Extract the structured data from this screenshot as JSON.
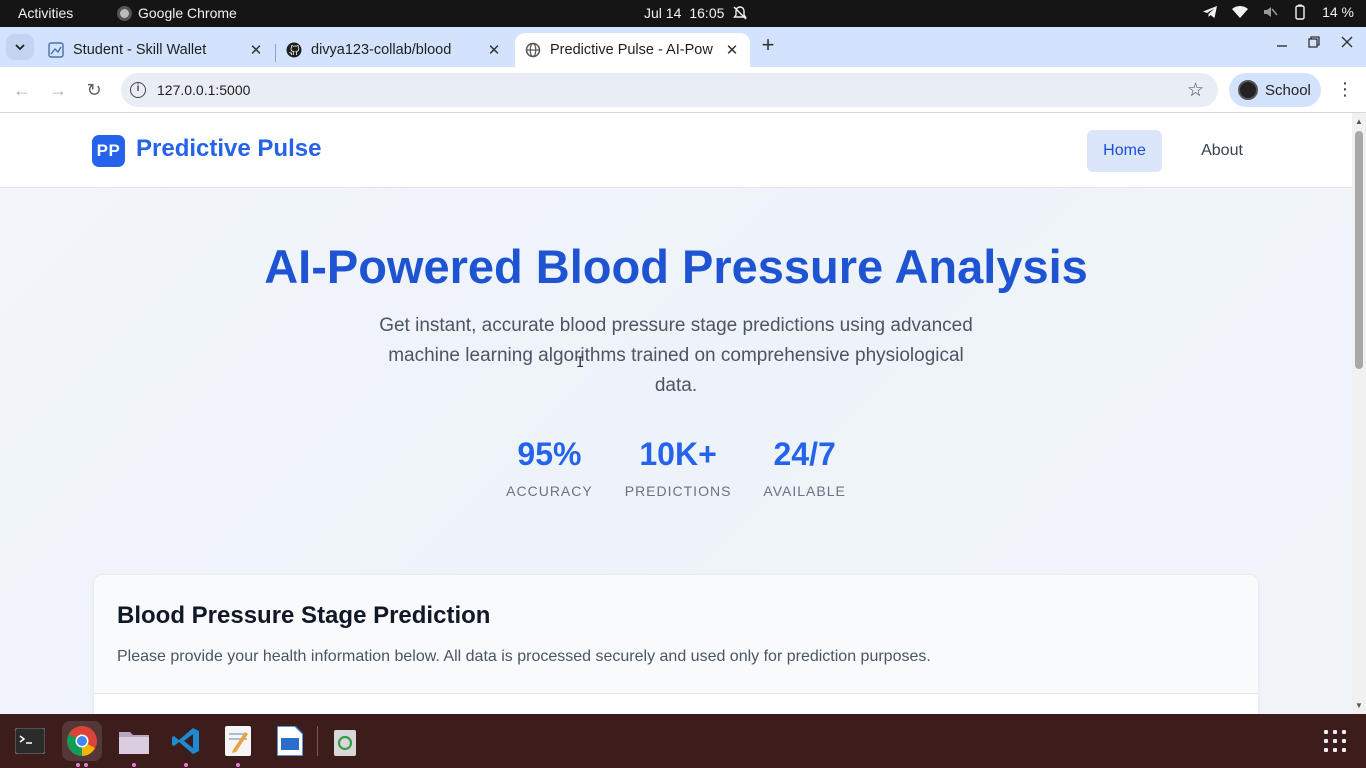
{
  "system": {
    "activities": "Activities",
    "app_name": "Google Chrome",
    "date": "Jul 14",
    "time": "16:05",
    "battery": "14 %"
  },
  "browser": {
    "tabs": [
      {
        "title": "Student - Skill Wallet",
        "icon": "skill-wallet-icon",
        "active": false
      },
      {
        "title": "divya123-collab/blood",
        "icon": "github-icon",
        "active": false
      },
      {
        "title": "Predictive Pulse - AI-Pow",
        "icon": "globe-icon",
        "active": true
      }
    ],
    "url": "127.0.0.1:5000",
    "profile_label": "School"
  },
  "site": {
    "logo_mark": "PP",
    "brand": "Predictive Pulse",
    "nav": {
      "home": "Home",
      "about": "About"
    },
    "hero": {
      "title": "AI-Powered Blood Pressure Analysis",
      "subtitle": "Get instant, accurate blood pressure stage predictions using advanced machine learning algorithms trained on comprehensive physiological data."
    },
    "stats": [
      {
        "value": "95%",
        "label": "ACCURACY"
      },
      {
        "value": "10K+",
        "label": "PREDICTIONS"
      },
      {
        "value": "24/7",
        "label": "AVAILABLE"
      }
    ],
    "card": {
      "title": "Blood Pressure Stage Prediction",
      "description": "Please provide your health information below. All data is processed securely and used only for prediction purposes."
    }
  },
  "colors": {
    "brand_blue": "#2563eb",
    "hero_title": "#1e54d2",
    "dock_bg": "#3d1c1c",
    "tabstrip_bg": "#d3e3fd"
  },
  "dock": [
    "terminal-icon",
    "chrome-icon",
    "files-icon",
    "vscode-icon",
    "text-editor-icon",
    "libreoffice-writer-icon",
    "trash-icon"
  ]
}
